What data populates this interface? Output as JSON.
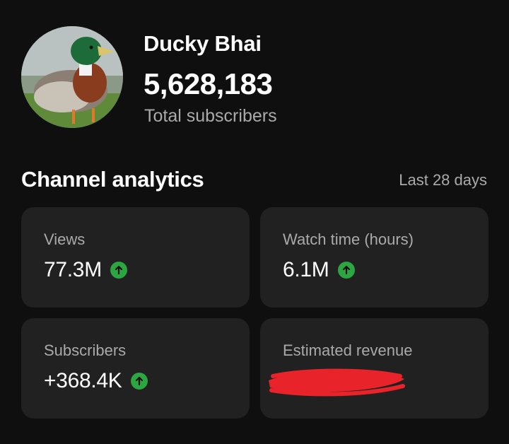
{
  "channel": {
    "name": "Ducky Bhai",
    "subscriber_count": "5,628,183",
    "subscriber_label": "Total subscribers",
    "avatar_icon": "duck-avatar"
  },
  "analytics": {
    "title": "Channel analytics",
    "period": "Last 28 days",
    "colors": {
      "card_bg": "#212121",
      "up_arrow": "#2ba640",
      "redaction": "#e8232a"
    },
    "cards": [
      {
        "label": "Views",
        "value": "77.3M",
        "trend_icon": "trend-up-icon"
      },
      {
        "label": "Watch time (hours)",
        "value": "6.1M",
        "trend_icon": "trend-up-icon"
      },
      {
        "label": "Subscribers",
        "value": "+368.4K",
        "trend_icon": "trend-up-icon"
      },
      {
        "label": "Estimated revenue",
        "value": "",
        "redacted": true
      }
    ]
  }
}
